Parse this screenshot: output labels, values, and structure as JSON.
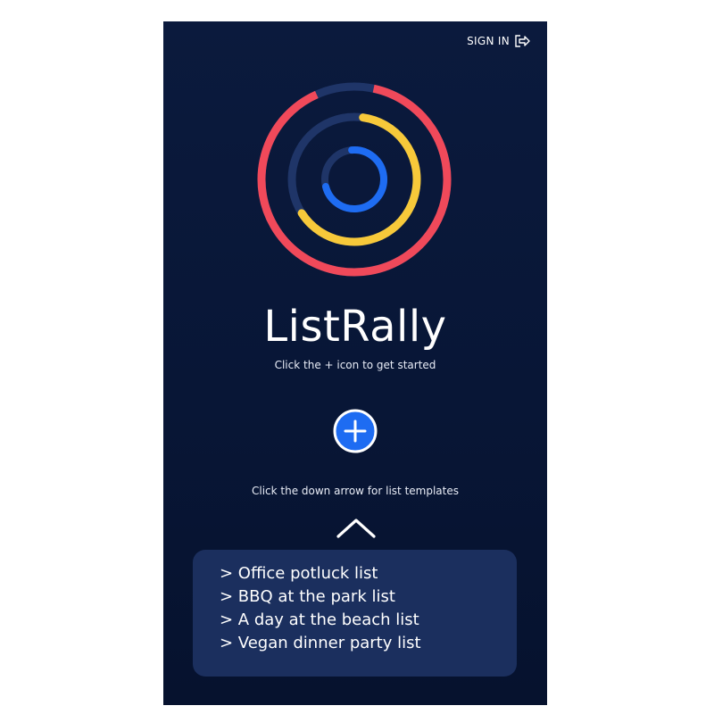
{
  "header": {
    "signin_label": "SIGN IN",
    "signin_icon": "sign-in-icon"
  },
  "logo": {
    "icon": "concentric-rings-logo",
    "colors": {
      "outer": "#f0495a",
      "middle": "#f7c93a",
      "inner": "#1e6cf2",
      "track": "#1f3568"
    }
  },
  "main": {
    "title": "ListRally",
    "subtitle": "Click the + icon to get started",
    "add_icon": "plus-circle-icon",
    "templates_hint": "Click the down arrow for list templates",
    "arrow_icon": "chevron-up-icon"
  },
  "templates": {
    "items": [
      "> Office potluck list",
      "> BBQ at the park list",
      "> A day at the beach list",
      "> Vegan dinner party list"
    ]
  },
  "colors": {
    "background": "#0b1a3d",
    "panel": "#1b2f5e",
    "accent": "#1e6cf2"
  }
}
